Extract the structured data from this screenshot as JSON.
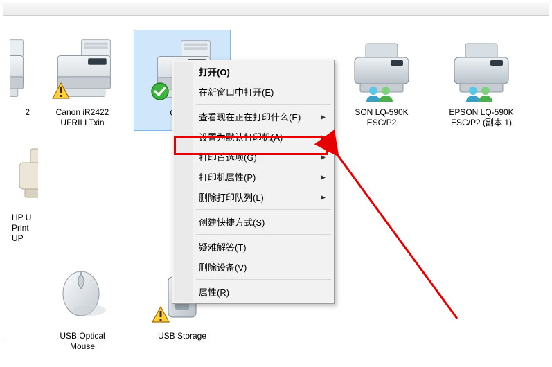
{
  "toolbar": {
    "b1": "",
    "b2": "",
    "b3": ""
  },
  "devices": {
    "d0": {
      "label": "2"
    },
    "d1": {
      "label": "Canon iR2422\nUFRII LTxin"
    },
    "d2": {
      "label": "Canon\nU"
    },
    "d3": {
      "label": "SON LQ-590K\nESC/P2"
    },
    "d4": {
      "label": "EPSON LQ-590K\nESC/P2 (副本 1)"
    },
    "d5": {
      "label": "HP U\nPrint\nUP"
    },
    "d6": {
      "label": "USB Optical\nMouse"
    },
    "d7": {
      "label": "USB Storage"
    }
  },
  "menu": {
    "open": "打开(O)",
    "openNew": "在新窗口中打开(E)",
    "seePrinting": "查看现在正在打印什么(E)",
    "setDefault": "设置为默认打印机(A)",
    "prefs": "打印首选项(G)",
    "props": "打印机属性(P)",
    "delQueue": "删除打印队列(L)",
    "shortcut": "创建快捷方式(S)",
    "troubleshoot": "疑难解答(T)",
    "delDevice": "删除设备(V)",
    "properties": "属性(R)"
  }
}
